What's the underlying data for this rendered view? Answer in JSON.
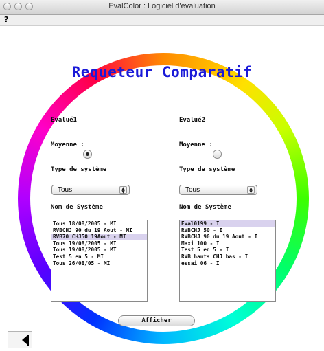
{
  "window": {
    "title": "EvalColor : Logiciel d'évaluation"
  },
  "menubar": {
    "help": "?"
  },
  "heading": "Requeteur Comparatif",
  "left": {
    "title": "Evalué1",
    "moyenne_label": "Moyenne :",
    "moyenne_selected": true,
    "type_label": "Type de système",
    "type_value": "Tous",
    "nom_label": "Nom de Système",
    "items": [
      "Tous 18/08/2005 - MI",
      "RVBCHJ 90 du 19 Aout - MI",
      "RVB70 CHJ50 19Aout - MI",
      "Tous 19/08/2005 - MI",
      "Tous 19/08/2005 - MT",
      "Test 5 en 5 - MI",
      "Tous 26/08/05 - MI"
    ],
    "selected_index": 2
  },
  "right": {
    "title": "Evalué2",
    "moyenne_label": "Moyenne :",
    "moyenne_selected": false,
    "type_label": "Type de système",
    "type_value": "Tous",
    "nom_label": "Nom de Système",
    "items": [
      "Eval0199 - I",
      "RVBCHJ 50 - I",
      "RVBCHJ 90 du 19 Aout - I",
      "Maxi 100 - I",
      "Test 5 en 5 - I",
      "RVB hauts CHJ bas - I",
      "essai 06 - I"
    ],
    "selected_index": 0
  },
  "button": {
    "afficher": "Afficher"
  },
  "colors": {
    "heading": "#1a1ad8",
    "selection": "#d9d2ee"
  }
}
